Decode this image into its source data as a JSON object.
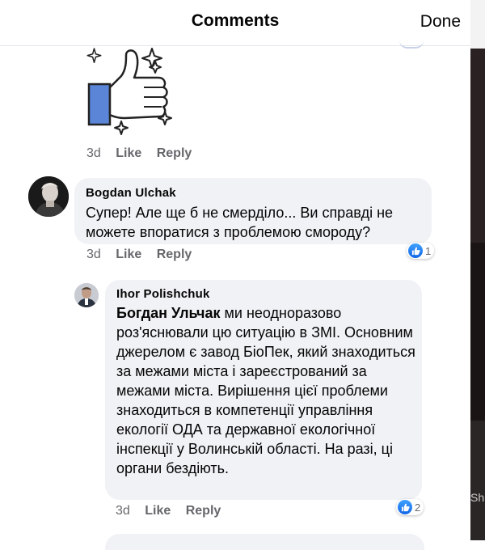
{
  "header": {
    "title": "Comments",
    "done_label": "Done"
  },
  "sticker": {
    "icon": "thumbs-up-sparkle-icon",
    "color": "#5b85d6"
  },
  "sticker_meta": {
    "time": "3d",
    "like": "Like",
    "reply": "Reply"
  },
  "comment1": {
    "author": "Bogdan  Ulchak",
    "text": "Супер! Але ще б не смерділо... Ви справді не можете впоратися з проблемою смороду?",
    "meta": {
      "time": "3d",
      "like": "Like",
      "reply": "Reply"
    },
    "reaction_count": "1"
  },
  "reply1": {
    "author": "Ihor Polishchuk",
    "mention": "Богдан Ульчак",
    "text": "ми неодноразово роз'яснювали цю ситуацію в ЗМІ. Основним джерелом є  завод БіоПек, який знаходиться за межами міста і зареєстрований за межами міста. Вирішення цієї проблеми знаходиться в компетенції управління екології ОДА та державної екологічної інспекції у Волинській області. На разі, ці органи бездіють.",
    "meta": {
      "time": "3d",
      "like": "Like",
      "reply": "Reply"
    },
    "reaction_count": "2"
  },
  "side_text": "Sh",
  "colors": {
    "accent_blue": "#1877f2",
    "bubble_bg": "#f0f2f5",
    "meta_gray": "#65676b"
  }
}
